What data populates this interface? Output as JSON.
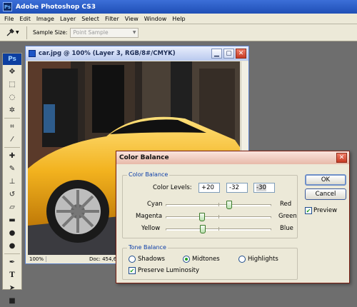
{
  "app": {
    "title": "Adobe Photoshop CS3",
    "logo_text": "Ps"
  },
  "menubar": {
    "items": [
      "File",
      "Edit",
      "Image",
      "Layer",
      "Select",
      "Filter",
      "View",
      "Window",
      "Help"
    ]
  },
  "options": {
    "sample_size_label": "Sample Size:",
    "sample_size_value": "Point Sample"
  },
  "toolbox": {
    "badge": "Ps",
    "tools": [
      "move-tool-icon",
      "marquee-tool-icon",
      "lasso-tool-icon",
      "magic-wand-tool-icon",
      "crop-tool-icon",
      "eyedropper-tool-icon",
      "healing-brush-tool-icon",
      "brush-tool-icon",
      "clone-stamp-tool-icon",
      "history-brush-tool-icon",
      "eraser-tool-icon",
      "gradient-tool-icon",
      "blur-tool-icon",
      "dodge-tool-icon",
      "pen-tool-icon",
      "type-tool-icon",
      "path-selection-tool-icon",
      "rectangle-tool-icon"
    ]
  },
  "document": {
    "title": "car.jpg @ 100% (Layer 3, RGB/8#/CMYK)",
    "zoom": "100%",
    "doc_size": "Doc: 454,6K"
  },
  "dialog": {
    "title": "Color Balance",
    "color_balance_group": "Color Balance",
    "color_levels_label": "Color Levels:",
    "levels": [
      "+20",
      "-32",
      "-30"
    ],
    "sliders": [
      {
        "left": "Cyan",
        "right": "Red",
        "value": 20
      },
      {
        "left": "Magenta",
        "right": "Green",
        "value": -32
      },
      {
        "left": "Yellow",
        "right": "Blue",
        "value": -30
      }
    ],
    "tone_balance_group": "Tone Balance",
    "tones": {
      "shadows": "Shadows",
      "midtones": "Midtones",
      "highlights": "Highlights",
      "selected": "Midtones"
    },
    "preserve_luminosity": "Preserve Luminosity",
    "preserve_checked": true,
    "ok": "OK",
    "cancel": "Cancel",
    "preview": "Preview",
    "preview_checked": true
  },
  "colors": {
    "accent_group_title": "#0b3da8",
    "check_mark": "#21a121",
    "car_body": "#f2b21e"
  }
}
